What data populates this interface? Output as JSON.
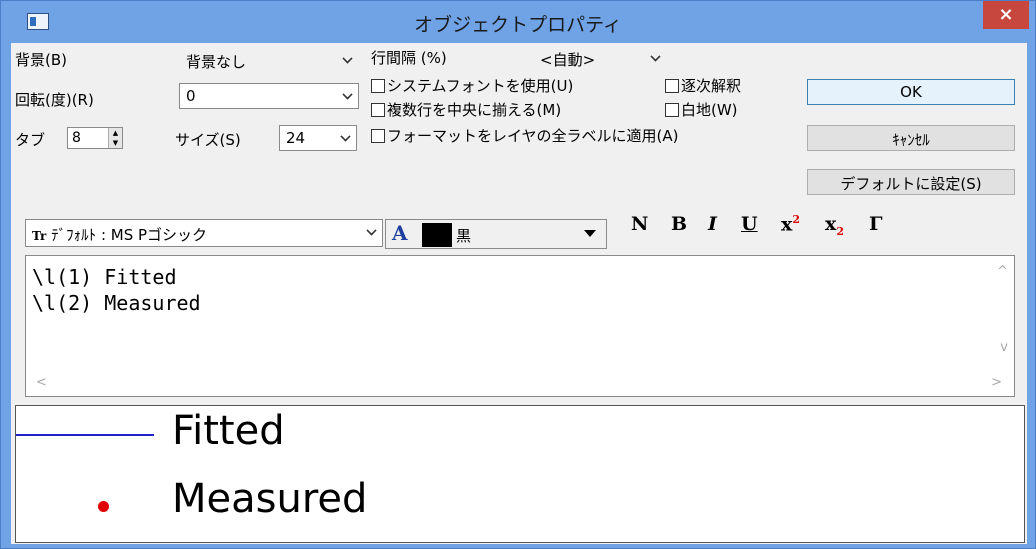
{
  "window": {
    "title": "オブジェクトプロパティ",
    "close": "×"
  },
  "labels": {
    "background": "背景(B)",
    "rotation": "回転(度)(R)",
    "tab": "タブ",
    "size": "サイズ(S)",
    "line_spacing": "行間隔 (%)"
  },
  "values": {
    "background": "背景なし",
    "rotation": "0",
    "tab": "8",
    "size": "24",
    "line_spacing": "<自動>"
  },
  "checkboxes": {
    "system_font": "システムフォントを使用(U)",
    "sequential": "逐次解釈",
    "multiline_center": "複数行を中央に揃える(M)",
    "white_bg": "白地(W)",
    "apply_all": "フォーマットをレイヤの全ラベルに適用(A)"
  },
  "buttons": {
    "ok": "OK",
    "cancel": "ｷｬﾝｾﾙ",
    "set_default": "デフォルトに設定(S)"
  },
  "font": {
    "icon": "Tr",
    "value": "ﾃﾞﾌｫﾙﾄ : MS Pゴシック"
  },
  "color": {
    "icon": "A",
    "name": "黒",
    "swatch": "#000000"
  },
  "format_buttons": {
    "normal": "N",
    "bold": "B",
    "italic": "I",
    "underline": "U",
    "superscript": "x",
    "subscript": "x",
    "greek": "Γ",
    "script_digit": "2"
  },
  "editor": {
    "line1": "\\l(1) Fitted",
    "line2": "\\l(2) Measured"
  },
  "preview": {
    "entry1": "Fitted",
    "entry2": "Measured",
    "line_color": "#2222cc",
    "dot_color": "#e00000"
  }
}
